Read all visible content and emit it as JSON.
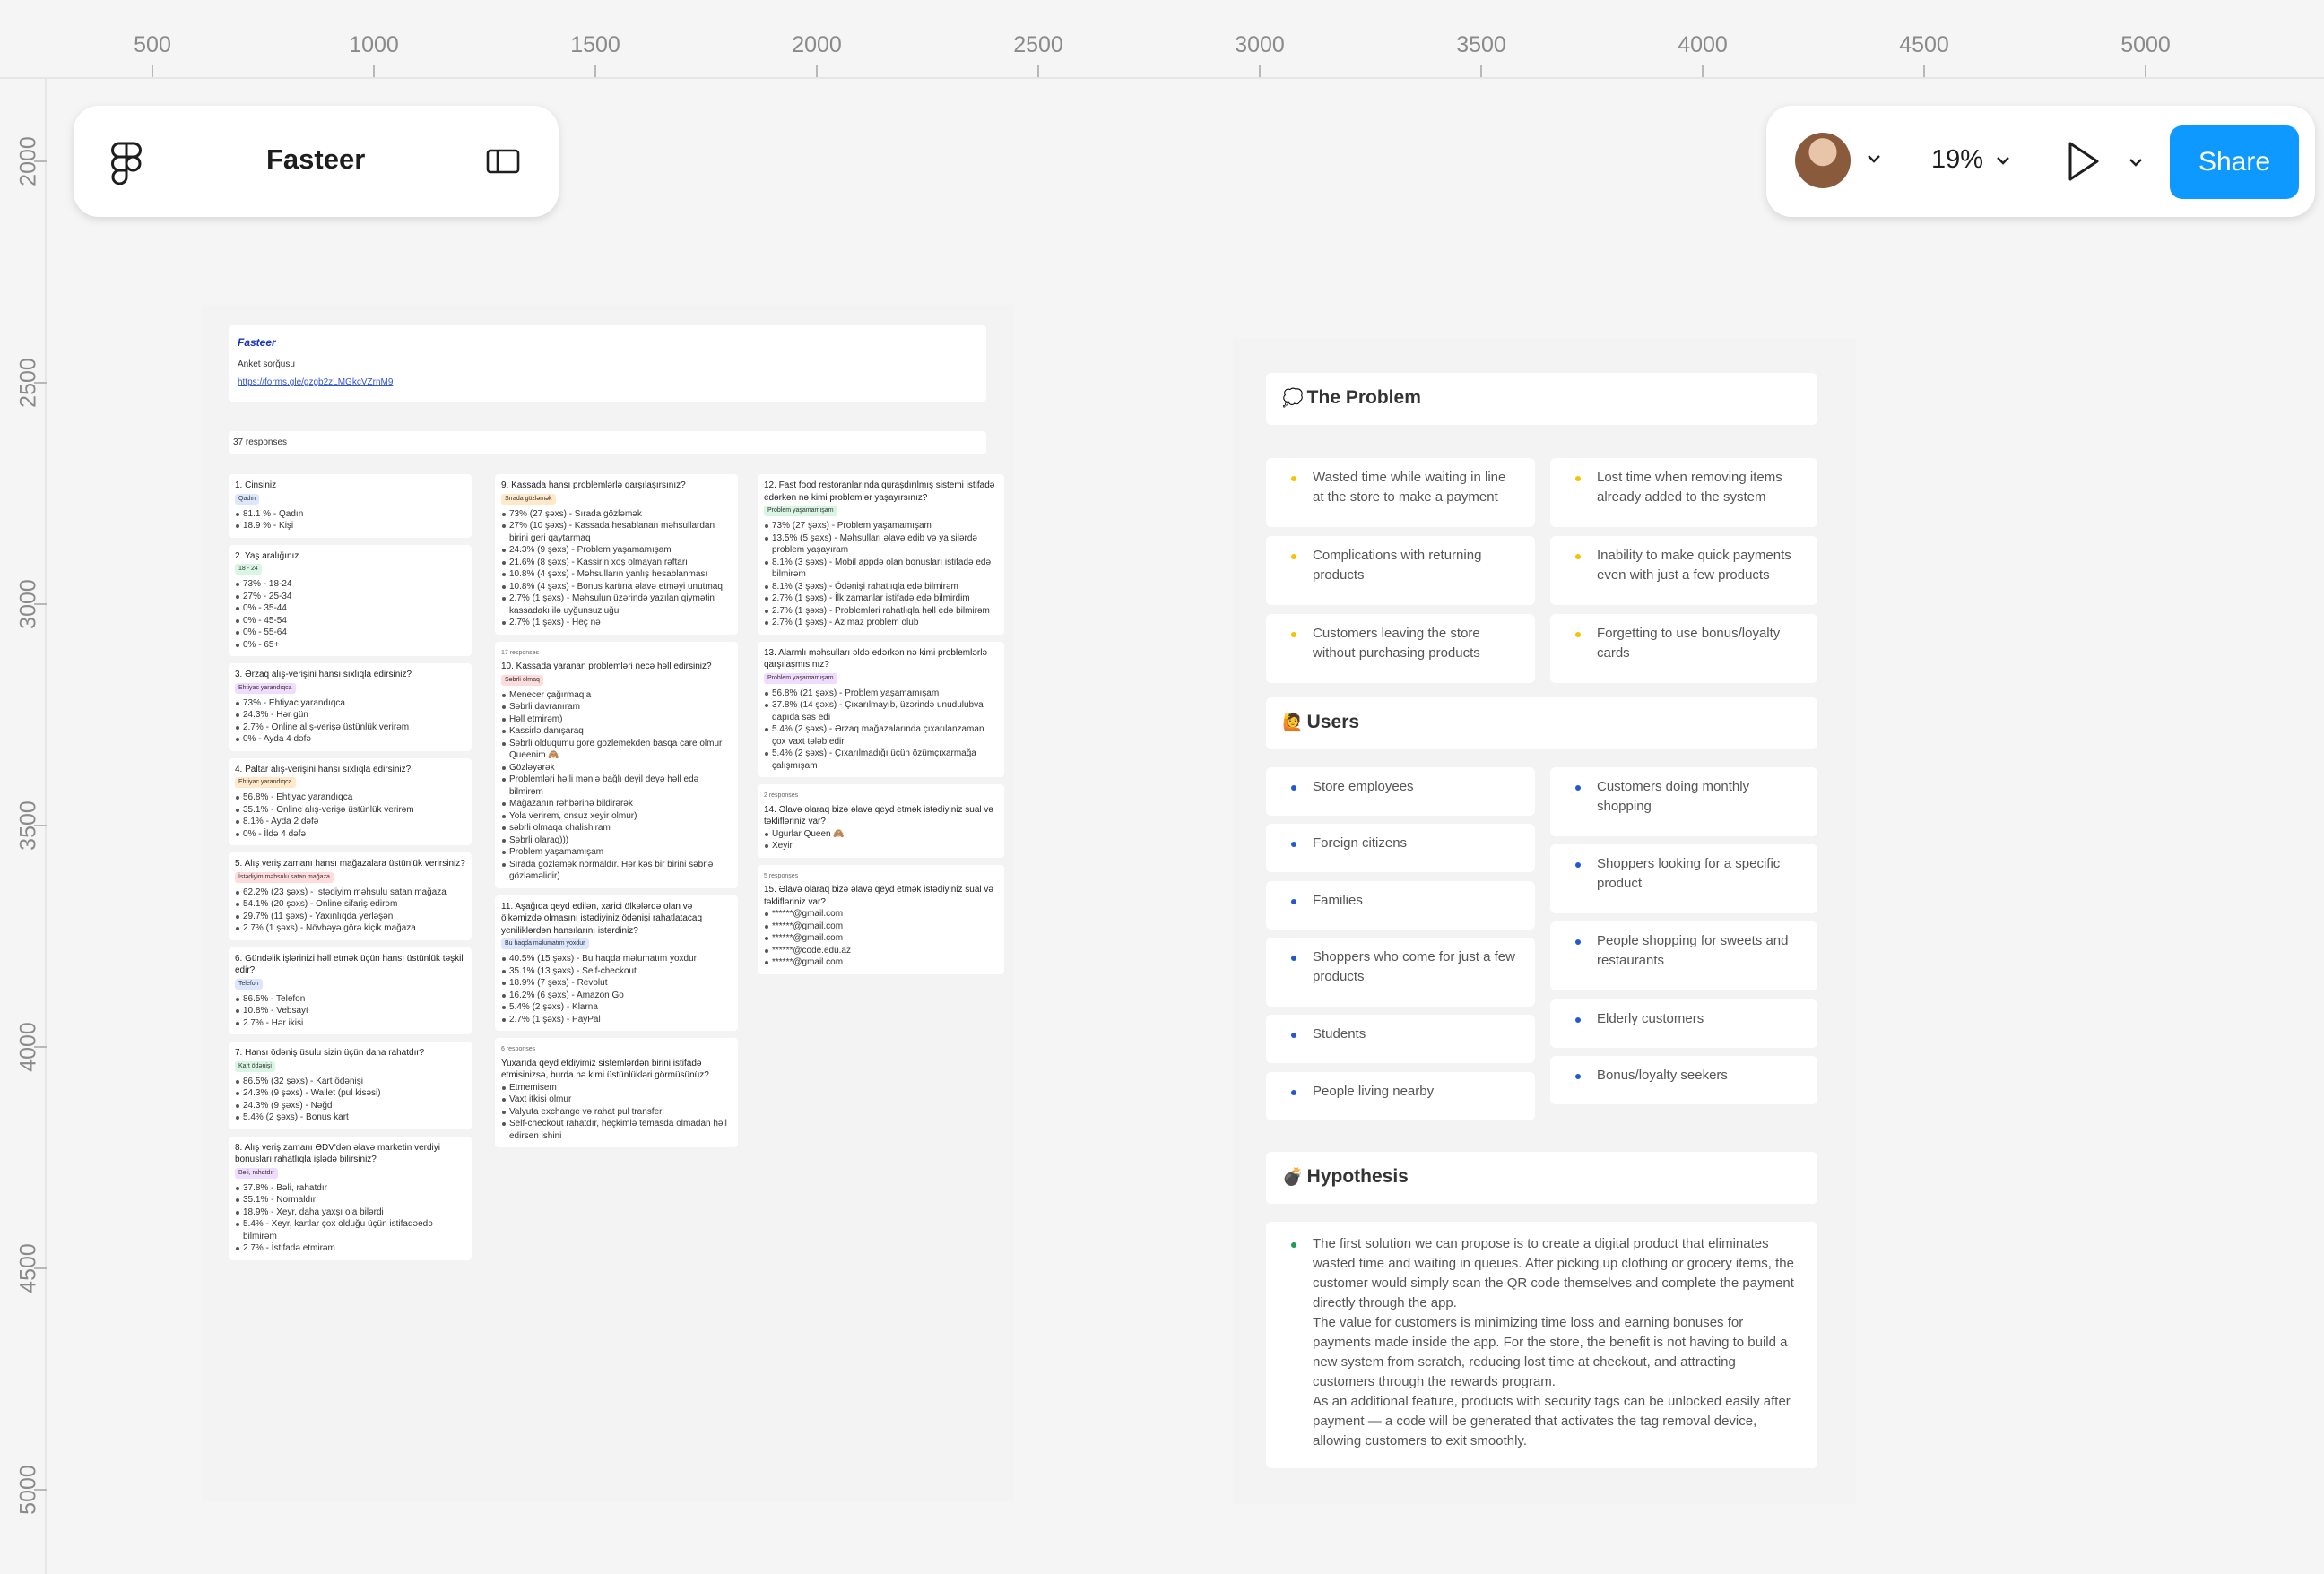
{
  "ruler": {
    "top": [
      "500",
      "1000",
      "1500",
      "2000",
      "2500",
      "3000",
      "3500",
      "4000",
      "4500",
      "5000"
    ],
    "left": [
      "2000",
      "2500",
      "3000",
      "3500",
      "4000",
      "4500",
      "5000"
    ]
  },
  "toolbar": {
    "file_name": "Fasteer",
    "zoom": "19%",
    "share_label": "Share"
  },
  "form": {
    "brand": "Fasteer",
    "subtitle": "Anket sorğusu",
    "link": "https://forms.gle/gzgb2zLMGkcVZrnM9",
    "responses": "37 responses"
  },
  "questions": [
    {
      "col": 0,
      "title": "1. Cinsiniz",
      "tag": "Qadın",
      "tag_color": "#dbe7ff",
      "items": [
        "81.1 % - Qadın",
        "18.9 % - Kişi"
      ]
    },
    {
      "col": 0,
      "title": "2. Yaş aralığınız",
      "tag": "18 - 24",
      "tag_color": "#d9f5e3",
      "items": [
        "73% - 18-24",
        "27% - 25-34",
        "0% - 35-44",
        "0% - 45-54",
        "0% - 55-64",
        "0% - 65+"
      ]
    },
    {
      "col": 0,
      "title": "3. Ərzaq alış-verişini hansı sıxlıqla edirsiniz?",
      "tag": "Ehtiyac yarandıqca",
      "tag_color": "#f0dcff",
      "items": [
        "73% - Ehtiyac yarandıqca",
        "24.3% - Hər gün",
        "2.7% - Online alış-verişə üstünlük verirəm",
        "0% - Ayda 4 dəfə"
      ]
    },
    {
      "col": 0,
      "title": "4. Paltar alış-verişini hansı sıxlıqla edirsiniz?",
      "tag": "Ehtiyac yarandıqca",
      "tag_color": "#ffe9c9",
      "items": [
        "56.8% - Ehtiyac yarandıqca",
        "35.1% - Online alış-verişə üstünlük verirəm",
        "8.1% - Ayda 2 dəfə",
        "0% - İldə 4 dəfə"
      ]
    },
    {
      "col": 0,
      "title": "5. Alış veriş zamanı hansı mağazalara üstünlük verirsiniz?",
      "tag": "İstədiyim məhsulu satan mağaza",
      "tag_color": "#ffdcdc",
      "items": [
        "62.2% (23 şəxs) - İstədiyim məhsulu satan mağaza",
        "54.1% (20 şəxs) - Online sifariş edirəm",
        "29.7% (11 şəxs) - Yaxınlıqda yerləşən",
        "2.7% (1 şəxs) - Növbəyə görə kiçik mağaza"
      ]
    },
    {
      "col": 0,
      "title": "6. Gündəlik işlərinizi həll etmək üçün hansı üstünlük təşkil edir?",
      "tag": "Telefon",
      "tag_color": "#dbe7ff",
      "items": [
        "86.5% - Telefon",
        "10.8% - Vebsayt",
        "2.7% - Hər ikisi"
      ]
    },
    {
      "col": 0,
      "title": "7. Hansı ödəniş üsulu sizin üçün daha rahatdır?",
      "tag": "Kart ödənişi",
      "tag_color": "#d9f5e3",
      "items": [
        "86.5% (32 şəxs) - Kart ödənişi",
        "24.3% (9 şəxs) - Wallet (pul kisəsi)",
        "24.3% (9 şəxs) - Nəğd",
        "5.4% (2 şəxs) - Bonus kart"
      ]
    },
    {
      "col": 0,
      "title": "8. Alış veriş zamanı ƏDV'dən əlavə marketin verdiyi bonusları rahatlıqla işlədə bilirsiniz?",
      "tag": "Bəli, rahatdır",
      "tag_color": "#f0dcff",
      "items": [
        "37.8% - Bəli, rahatdır",
        "35.1% - Normaldır",
        "18.9% - Xeyr, daha yaxşı ola bilərdi",
        "5.4% - Xeyr, kartlar çox olduğu üçün istifadəedə bilmirəm",
        "2.7% - İstifadə etmirəm"
      ]
    },
    {
      "col": 1,
      "title": "9. Kassada hansı problemlərlə qarşılaşırsınız?",
      "tag": "Sırada gözləmək",
      "tag_color": "#ffe9c9",
      "items": [
        "73% (27 şəxs) - Sırada gözləmək",
        "27% (10 şəxs) - Kassada hesablanan məhsullardan birini geri qaytarmaq",
        "24.3% (9 şəxs) - Problem yaşamamışam",
        "21.6% (8 şəxs) - Kassirin xoş olmayan rəftarı",
        "10.8% (4 şəxs) - Məhsulların yanlış hesablanması",
        "10.8% (4 şəxs) - Bonus kartına əlavə etməyi unutmaq",
        "2.7% (1 şəxs) - Məhsulun üzərində yazılan qiymətin kassadakı ilə uyğunsuzluğu",
        "2.7% (1 şəxs) - Heç nə"
      ]
    },
    {
      "col": 1,
      "count": "17 responses",
      "title": "10. Kassada yaranan problemləri necə həll edirsiniz?",
      "tag": "Səbrli olmaq",
      "tag_color": "#ffdcdc",
      "items": [
        "Menecer çağırmaqla",
        "Səbrli davranıram",
        "Həll etmirəm)",
        "Kassirlə danışaraq",
        "Səbrli olduqumu gore gozlemekden basqa care olmur Queenim 🙈",
        "Gözləyərək",
        "Problemləri həlli mənlə bağlı deyil deyə həll edə bilmirəm",
        "Mağazanın rəhbərinə bildirərək",
        "Yola verirem, onsuz xeyir olmur)",
        "səbrli olmaqa chalishiram",
        "Səbrli olaraq)))",
        "Problem yaşamamışam",
        "Sırada gözləmək normaldır. Hər kəs bir birini səbrlə gözləməlidir)"
      ]
    },
    {
      "col": 1,
      "title": "11. Aşağıda qeyd edilən, xarici ölkələrdə olan və ölkəmizdə olmasını istədiyiniz ödənişi rahatlatacaq yeniliklərdən hansılarını istərdiniz?",
      "tag": "Bu haqda məlumatım yoxdur",
      "tag_color": "#dbe7ff",
      "items": [
        "40.5% (15 şəxs) - Bu haqda məlumatım yoxdur",
        "35.1% (13 şəxs) - Self-checkout",
        "18.9% (7 şəxs) - Revolut",
        "16.2% (6 şəxs) - Amazon Go",
        "5.4% (2 şəxs) - Klarna",
        "2.7% (1 şəxs) - PayPal"
      ]
    },
    {
      "col": 1,
      "count": "6 responses",
      "title": "Yuxarıda qeyd etdiyimiz sistemlərdən birini istifadə etmisinizsə, burda nə kimi üstünlükləri görmüsünüz?",
      "tag": "",
      "tag_color": "",
      "items": [
        "Etmemisem",
        "Vaxt itkisi olmur",
        "Valyuta exchange və rahat pul transferi",
        "Self-checkout rahatdır, heçkimlə temasda olmadan həll edirsen ishini"
      ]
    },
    {
      "col": 2,
      "title": "12. Fast food restoranlarında quraşdırılmış sistemi istifadə edərkən nə kimi problemlər yaşayırsınız?",
      "tag": "Problem yaşamamışam",
      "tag_color": "#d9f5e3",
      "items": [
        "73% (27 şəxs) - Problem yaşamamışam",
        "13.5% (5 şəxs) - Məhsulları əlavə edib və ya silərdə problem yaşayıram",
        "8.1% (3 şəxs) - Mobil appdə olan bonusları istifadə edə bilmirəm",
        "8.1% (3 şəxs) - Ödənişi rahatlıqla edə bilmirəm",
        "2.7% (1 şəxs) - İlk zamanlar istifadə edə bilmirdim",
        "2.7% (1 şəxs) - Problemləri rahatlıqla həll edə bilmirəm",
        "2.7% (1 şəxs) - Az maz problem olub"
      ]
    },
    {
      "col": 2,
      "title": "13. Alarmlı məhsulları əldə edərkən nə kimi problemlərlə qarşılaşmısınız?",
      "tag": "Problem yaşamamışam",
      "tag_color": "#f0dcff",
      "items": [
        "56.8% (21 şəxs) - Problem yaşamamışam",
        "37.8% (14 şəxs) - Çıxarılmayıb, üzərində unudulubva qapıda səs edi",
        "5.4% (2 şəxs) - Ərzaq mağazalarında çıxarılanzaman çox vaxt tələb edir",
        "5.4% (2 şəxs) - Çıxarılmadığı üçün özümçıxarmağa çalışmışam"
      ]
    },
    {
      "col": 2,
      "count": "2 responses",
      "title": "14. Əlavə olaraq bizə əlavə qeyd etmək istədiyiniz sual və təklifləriniz var?",
      "tag": "",
      "tag_color": "",
      "items": [
        "Ugurlar Queen 🙈",
        "Xeyir"
      ]
    },
    {
      "col": 2,
      "count": "5 responses",
      "title": "15. Əlavə olaraq bizə əlavə qeyd etmək istədiyiniz sual və təklifləriniz var?",
      "tag": "",
      "tag_color": "",
      "items": [
        "******@gmail.com",
        "******@gmail.com",
        "******@gmail.com",
        "******@code.edu.az",
        "******@gmail.com"
      ]
    }
  ],
  "sections": {
    "problem": {
      "emoji": "💭",
      "title": "The Problem",
      "dot_color": "#f5c400",
      "items": [
        "Wasted time while waiting in line at the store to make a payment",
        "Lost time when removing items already added to the system",
        "Complications with returning products",
        "Inability to make quick payments even with just a few products",
        "Customers leaving the store without purchasing products",
        "Forgetting to use bonus/loyalty cards"
      ]
    },
    "users": {
      "emoji": "🙋",
      "title": "Users",
      "dot_color": "#2457d6",
      "left": [
        "Store employees",
        "Foreign citizens",
        "Families",
        "Shoppers who come for just a few products",
        "Students",
        "People living nearby"
      ],
      "right": [
        "Customers doing monthly shopping",
        "Shoppers looking for a specific product",
        "People shopping for sweets and restaurants",
        "Elderly customers",
        "Bonus/loyalty seekers"
      ]
    },
    "hypothesis": {
      "emoji": "💣",
      "title": "Hypothesis",
      "dot_color": "#1f9d55",
      "paragraphs": [
        "The first solution we can propose is to create a digital product that eliminates wasted time and waiting in queues. After picking up clothing or grocery items, the customer would simply scan the QR code themselves and complete the payment directly through the app.",
        "The value for customers is minimizing time loss and earning bonuses for payments made inside the app. For the store, the benefit is not having to build a new system from scratch, reducing lost time at checkout, and attracting customers through the rewards program.",
        "As an additional feature, products with security tags can be unlocked easily after payment — a code will be generated that activates the tag removal device, allowing customers to exit smoothly."
      ]
    }
  }
}
